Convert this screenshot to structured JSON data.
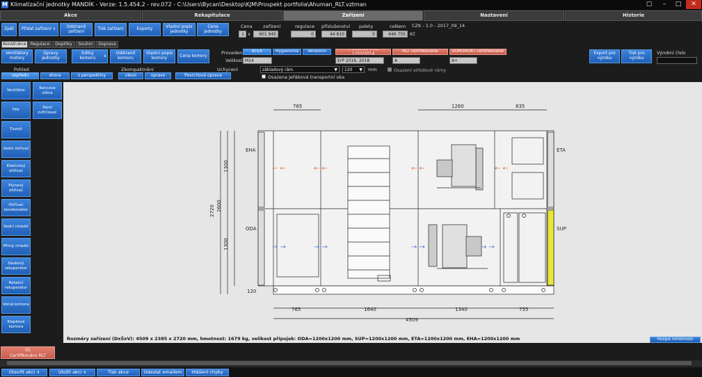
{
  "window": {
    "title": "Klimatizační jednotky MANDÍK - Verze: 1.5.454.2 - rev.072 - C:\\Users\\Bycan\\Desktop\\KJM\\Prospekt portfolia\\Ahuman_RLT.vztman",
    "icon": "M",
    "controls": [
      "minimize-icon",
      "maximize-icon",
      "close-icon"
    ]
  },
  "main_tabs": [
    "Akce",
    "Rekapitulace",
    "Zařízení",
    "Nastavení",
    "Historie"
  ],
  "toolbar": {
    "zpet": "Zpět",
    "pridat": "Přidat zařízení",
    "odstranit": "Odstranit zařízení",
    "tisk": "Tisk zařízení",
    "exporty": "Exporty",
    "vlastni_popis": "Vlastní popis jednotky",
    "cena": "Cena jednotky",
    "caret": "∨"
  },
  "summary": {
    "headers": [
      "Cena",
      "zařízení",
      "regulace",
      "příslušenství",
      "palety",
      "celkem"
    ],
    "qty": "1",
    "x": "x",
    "zarizeni": "601 945",
    "regulace": "0",
    "prislusenstvi": "44 810",
    "palety": "0",
    "celkem": "646 755",
    "currency": "Kč",
    "price_list": "CZK - 1.0 - 2017_09_14"
  },
  "sub_tabs": [
    "Konstrukce",
    "Regulace",
    "Doplňky",
    "Souhrn",
    "Doprava"
  ],
  "konstrukce": {
    "ventilatory": "Ventilátory motory",
    "upravy": "Úpravy jednotky",
    "editujte": "Edituj komoru",
    "odstranit": "Odstranit komoru",
    "vlastni_popis": "Vlastní popis komory",
    "cena": "Cena komory"
  },
  "provedeni": {
    "label": "Provedení",
    "opts": [
      "ATEX",
      "Hygienická",
      "Venkovní"
    ],
    "red": [
      "V souladu s EU 1253/2014",
      "RLT certifikované",
      "EUROVENT certifikované"
    ]
  },
  "velikost": {
    "label": "Velikost",
    "value": "M14",
    "erp": "ErP 2016, 2018",
    "a1": "A",
    "a2": "A+"
  },
  "export": {
    "export": "Export pro výrobu",
    "tisk": "Tisk pro výrobu",
    "vyrobni": "Výrobní číslo",
    "vyrobni_value": ""
  },
  "pohled": {
    "label": "Pohled",
    "zpredu": "zepředu",
    "shora": "shora",
    "perspektiva": "z perspektivy"
  },
  "zkompaktneni": {
    "label": "Zkompaktnění",
    "vlevo": "vlevo",
    "vpravo": "vpravo",
    "povrchova": "Povrchová úprava"
  },
  "uchyceni": {
    "label": "Uchycení",
    "value": "základový rám",
    "num": "120",
    "unit": "mm",
    "osazeni_rama": "Osazení středové rámy",
    "osazena_jerab": "Osazena jeřábová transportní oka"
  },
  "side_buttons": [
    "Ventilátor",
    "Filtr",
    "Tlumič",
    "Vodní ohřívač",
    "Elektrický ohřívač",
    "Plynový ohřívač",
    "Ohřívač kondenzátor",
    "Vodní chladič",
    "Přímý chladič",
    "Deskový rekuperátor",
    "Rotační rekuperátor",
    "Volná komora",
    "Klapková komora"
  ],
  "side_buttons2": [
    "Koncová stěna",
    "Parní zvlhčovač"
  ],
  "drawing": {
    "top_dims": [
      "765",
      "1260",
      "835"
    ],
    "bottom_dims": [
      "765",
      "1640",
      "1340",
      "755"
    ],
    "total": "4509",
    "left_dims": [
      "2720",
      "2600",
      "1300",
      "1300",
      "120"
    ],
    "labels": [
      "EHA",
      "ODA",
      "ETA",
      "SUP"
    ]
  },
  "status": "Rozměry zařízení (DxŠxV): 4509 x 2385 x 2720 mm, hmotnost: 1679 kg, velikost přípojek: ODA=1200x1200 mm, SUP=1200x1200 mm, ETA=1200x1200 mm, EHA=1200x1200 mm",
  "rozpis": "Rozpis hmotnosti",
  "bottom_tab": {
    "num": "01",
    "label": "Certifikováno RLT"
  },
  "bottom_buttons": [
    "Otevřít akci",
    "Uložit akci",
    "Tisk akce",
    "Odeslat emailem",
    "Hlášení chyby"
  ]
}
